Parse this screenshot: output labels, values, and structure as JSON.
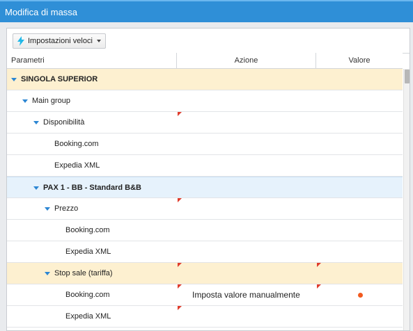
{
  "window": {
    "title": "Modifica di massa"
  },
  "toolbar": {
    "quick_settings_label": "Impostazioni veloci",
    "quick_settings_icon": "lightning-bolt-icon"
  },
  "table": {
    "columns": [
      "Parametri",
      "Azione",
      "Valore"
    ],
    "rows": [
      {
        "label": "SINGOLA SUPERIOR",
        "level": 0,
        "expandable": true,
        "bold": true,
        "highlight": "yellow"
      },
      {
        "label": "Main group",
        "level": 1,
        "expandable": true
      },
      {
        "label": "Disponibilità",
        "level": 2,
        "expandable": true,
        "flags": [
          "azione"
        ]
      },
      {
        "label": "Booking.com",
        "level": 3
      },
      {
        "label": "Expedia XML",
        "level": 3
      },
      {
        "label": "PAX 1 - BB - Standard B&B",
        "level": 2,
        "expandable": true,
        "bold": true,
        "highlight": "blue"
      },
      {
        "label": "Prezzo",
        "level": 3,
        "expandable": true,
        "flags": [
          "azione"
        ]
      },
      {
        "label": "Booking.com",
        "level": 4
      },
      {
        "label": "Expedia XML",
        "level": 4
      },
      {
        "label": "Stop sale (tariffa)",
        "level": 3,
        "expandable": true,
        "highlight": "yellow",
        "flags": [
          "azione",
          "valore"
        ]
      },
      {
        "label": "Booking.com",
        "level": 4,
        "action": "Imposta valore manualmente",
        "value_dot": true,
        "flags": [
          "azione",
          "valore"
        ]
      },
      {
        "label": "Expedia XML",
        "level": 4,
        "flags": [
          "azione"
        ]
      }
    ]
  },
  "colors": {
    "titlebar": "#2f8fd7",
    "accent": "#2c86d3",
    "flag": "#e03b2b",
    "dot": "#f25a1f",
    "row_yellow": "#fdf0d0",
    "row_blue": "#e6f2fc"
  }
}
